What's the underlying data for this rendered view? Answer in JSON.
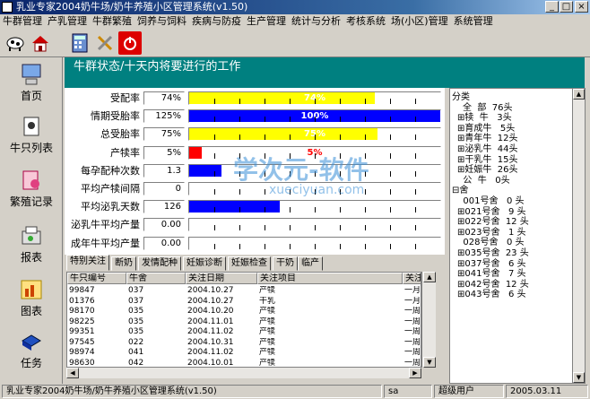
{
  "window": {
    "title": "乳业专家2004奶牛场/奶牛养殖小区管理系统(v1.50)",
    "min": "_",
    "max": "□",
    "close": "×"
  },
  "menu": [
    "牛群管理",
    "产乳管理",
    "牛群繁殖",
    "饲养与饲料",
    "疾病与防疫",
    "生产管理",
    "统计与分析",
    "考核系统",
    "场(小区)管理",
    "系统管理"
  ],
  "toolbar": [
    "cow-icon",
    "home-icon",
    "calculator-icon",
    "tools-icon",
    "power-icon"
  ],
  "nav": [
    "首页",
    "牛只列表",
    "繁殖记录",
    "报表",
    "图表",
    "任务"
  ],
  "header": {
    "title": "牛群状态/十天内将要进行的工作"
  },
  "stats": [
    {
      "label": "受配率",
      "value": "74%",
      "fill": 0.74,
      "color": "#ffff00",
      "text": "74%",
      "textcolor": "#ffffff"
    },
    {
      "label": "情期受胎率",
      "value": "125%",
      "fill": 1.0,
      "color": "#0000ff",
      "text": "100%",
      "textcolor": "#ffffff"
    },
    {
      "label": "总受胎率",
      "value": "75%",
      "fill": 0.75,
      "color": "#ffff00",
      "text": "75%",
      "textcolor": "#ffffff"
    },
    {
      "label": "产犊率",
      "value": "5%",
      "fill": 0.05,
      "color": "#ff0000",
      "text": "5%",
      "textcolor": "#ff0000"
    },
    {
      "label": "每孕配种次数",
      "value": "1.3",
      "fill": 0.13,
      "color": "#0000ff",
      "text": "",
      "textcolor": "#ffffff"
    },
    {
      "label": "平均产犊间隔",
      "value": "0",
      "fill": 0,
      "color": "#0000ff",
      "text": "",
      "textcolor": "#ffffff"
    },
    {
      "label": "平均泌乳天数",
      "value": "126",
      "fill": 0.36,
      "color": "#0000ff",
      "text": "",
      "textcolor": "#ffffff"
    },
    {
      "label": "泌乳牛平均产量",
      "value": "0.00",
      "fill": 0,
      "color": "#0000ff",
      "text": "",
      "textcolor": "#ffffff"
    },
    {
      "label": "成年牛平均产量",
      "value": "0.00",
      "fill": 0,
      "color": "#0000ff",
      "text": "",
      "textcolor": "#ffffff"
    }
  ],
  "tabs": [
    "特别关注",
    "断奶",
    "发情配种",
    "妊娠诊断",
    "妊娠检查",
    "干奶",
    "临产"
  ],
  "grid": {
    "columns": [
      "牛只编号",
      "牛舍",
      "关注日期",
      "关注项目",
      "关注"
    ],
    "rows": [
      [
        "99847",
        "037",
        "2004.10.27",
        "产犊",
        "一月"
      ],
      [
        "01376",
        "037",
        "2004.10.27",
        "干乳",
        "一月"
      ],
      [
        "98170",
        "035",
        "2004.10.20",
        "产犊",
        "一周"
      ],
      [
        "98225",
        "035",
        "2004.11.01",
        "产犊",
        "一周"
      ],
      [
        "99351",
        "035",
        "2004.11.02",
        "产犊",
        "一周"
      ],
      [
        "97545",
        "022",
        "2004.10.31",
        "产犊",
        "一周"
      ],
      [
        "98974",
        "041",
        "2004.11.02",
        "产犊",
        "一周"
      ],
      [
        "98630",
        "042",
        "2004.10.01",
        "产犊",
        "一周"
      ]
    ]
  },
  "tree": [
    {
      "text": "分类",
      "indent": 0
    },
    {
      "text": "全  部  76头",
      "indent": 2
    },
    {
      "text": "⊞犊  牛   3头",
      "indent": 1
    },
    {
      "text": "⊞育成牛   5头",
      "indent": 1
    },
    {
      "text": "⊞青年牛  12头",
      "indent": 1
    },
    {
      "text": "⊞泌乳牛  44头",
      "indent": 1
    },
    {
      "text": "⊞干乳牛  15头",
      "indent": 1
    },
    {
      "text": "⊞妊娠牛  26头",
      "indent": 1
    },
    {
      "text": "  公  牛   0头",
      "indent": 1
    },
    {
      "text": "⊟舍",
      "indent": 0
    },
    {
      "text": "  001号舍   0 头",
      "indent": 1
    },
    {
      "text": "⊞021号舍   9 头",
      "indent": 1
    },
    {
      "text": "⊞022号舍  12 头",
      "indent": 1
    },
    {
      "text": "⊞023号舍   1 头",
      "indent": 1
    },
    {
      "text": "  028号舍   0 头",
      "indent": 1
    },
    {
      "text": "⊞035号舍  23 头",
      "indent": 1
    },
    {
      "text": "⊞037号舍   6 头",
      "indent": 1
    },
    {
      "text": "⊞041号舍   7 头",
      "indent": 1
    },
    {
      "text": "⊞042号舍  12 头",
      "indent": 1
    },
    {
      "text": "⊞043号舍   6 头",
      "indent": 1
    }
  ],
  "status": {
    "app": "乳业专家2004奶牛场/奶牛养殖小区管理系统(v1.50)",
    "user_code": "sa",
    "role": "超级用户",
    "date": "2005.03.11"
  },
  "watermark": {
    "main": "学次元-软件",
    "sub": "xueciyuan.com"
  }
}
